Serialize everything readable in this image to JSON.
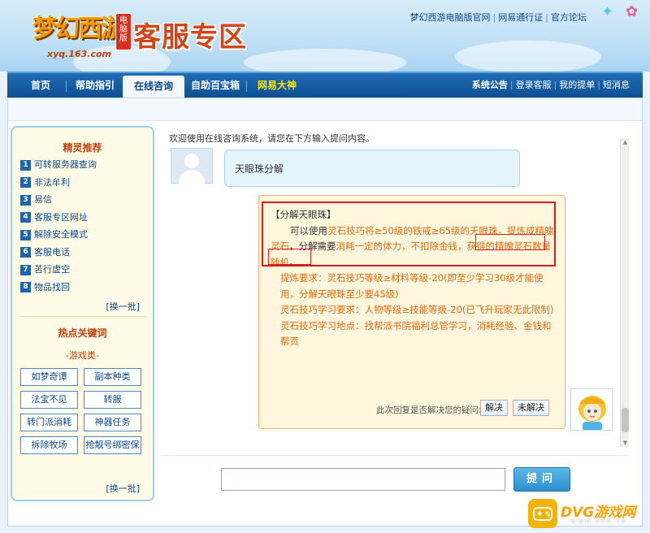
{
  "header": {
    "logo_text": "梦幻西游",
    "logo_badge": "电脑版",
    "logo_domain": "xyq.163.com",
    "site_title": "客服专区",
    "top_links": [
      "梦幻西游电脑版官网",
      "网易通行证",
      "官方论坛"
    ]
  },
  "nav": {
    "tabs": [
      {
        "label": "首页"
      },
      {
        "label": "帮助指引"
      },
      {
        "label": "在线咨询"
      },
      {
        "label": "自助百宝箱"
      },
      {
        "label": "网易大神"
      }
    ],
    "right_links": [
      "系统公告",
      "登录客服",
      "我的提单",
      "短消息"
    ]
  },
  "sidebar": {
    "recommend_title": "精灵推荐",
    "items": [
      {
        "num": "1",
        "label": "可转服务器查询"
      },
      {
        "num": "2",
        "label": "非法牟利"
      },
      {
        "num": "3",
        "label": "易信"
      },
      {
        "num": "4",
        "label": "客服专区网址"
      },
      {
        "num": "5",
        "label": "解除安全模式"
      },
      {
        "num": "6",
        "label": "客服电话"
      },
      {
        "num": "7",
        "label": "苦行虚空"
      },
      {
        "num": "8",
        "label": "物品找回"
      }
    ],
    "refresh_label": "[换一批]",
    "hot_title": "热点关键词",
    "category": "-游戏类-",
    "keywords": [
      "如梦奇谭",
      "副本种类",
      "法宝不见",
      "转服",
      "转门派消耗",
      "神器任务",
      "拆除牧场",
      "抢靓号绑密保"
    ],
    "refresh_label_2": "[换一批]"
  },
  "chat": {
    "welcome": "欢迎使用在线咨询系统，请您在下方输入提问内容。",
    "user_message": "天眼珠分解",
    "reply": {
      "title": "【分解天眼珠】",
      "para1_a": "可以使用",
      "para1_b": "灵石技巧将≥50级的铁戒≥65级的天眼珠，提炼成精魄灵石",
      "para1_c": "，分解需要",
      "para1_d": "消耗一定的体力，不扣除金钱，获得的精魄灵石数量随机",
      "para1_e": "。",
      "line2": "提炼要求：灵石技巧等级≥材料等级-20(即至少学习30级才能使用，分解天眼珠至少要45级)",
      "line3": "灵石技巧学习要求：人物等级≥技能等级-20(已飞升玩家无此限制)",
      "line4": "灵石技巧学习地点：找帮派书院福利总管学习，消耗经验、金钱和帮贡"
    },
    "feedback_question": "此次回复是否解决您的疑问:",
    "resolved_label": "解决",
    "unresolved_label": "未解决"
  },
  "input": {
    "placeholder": "",
    "ask_label": "提问"
  },
  "watermark": {
    "text": "DVG游戏网",
    "url": "WWW.DVG.CN"
  },
  "colors": {
    "nav_blue": "#0e4f93",
    "accent_orange": "#e06a10",
    "highlight_red": "#d81e1e",
    "sidebar_bg": "#fffbe6"
  }
}
